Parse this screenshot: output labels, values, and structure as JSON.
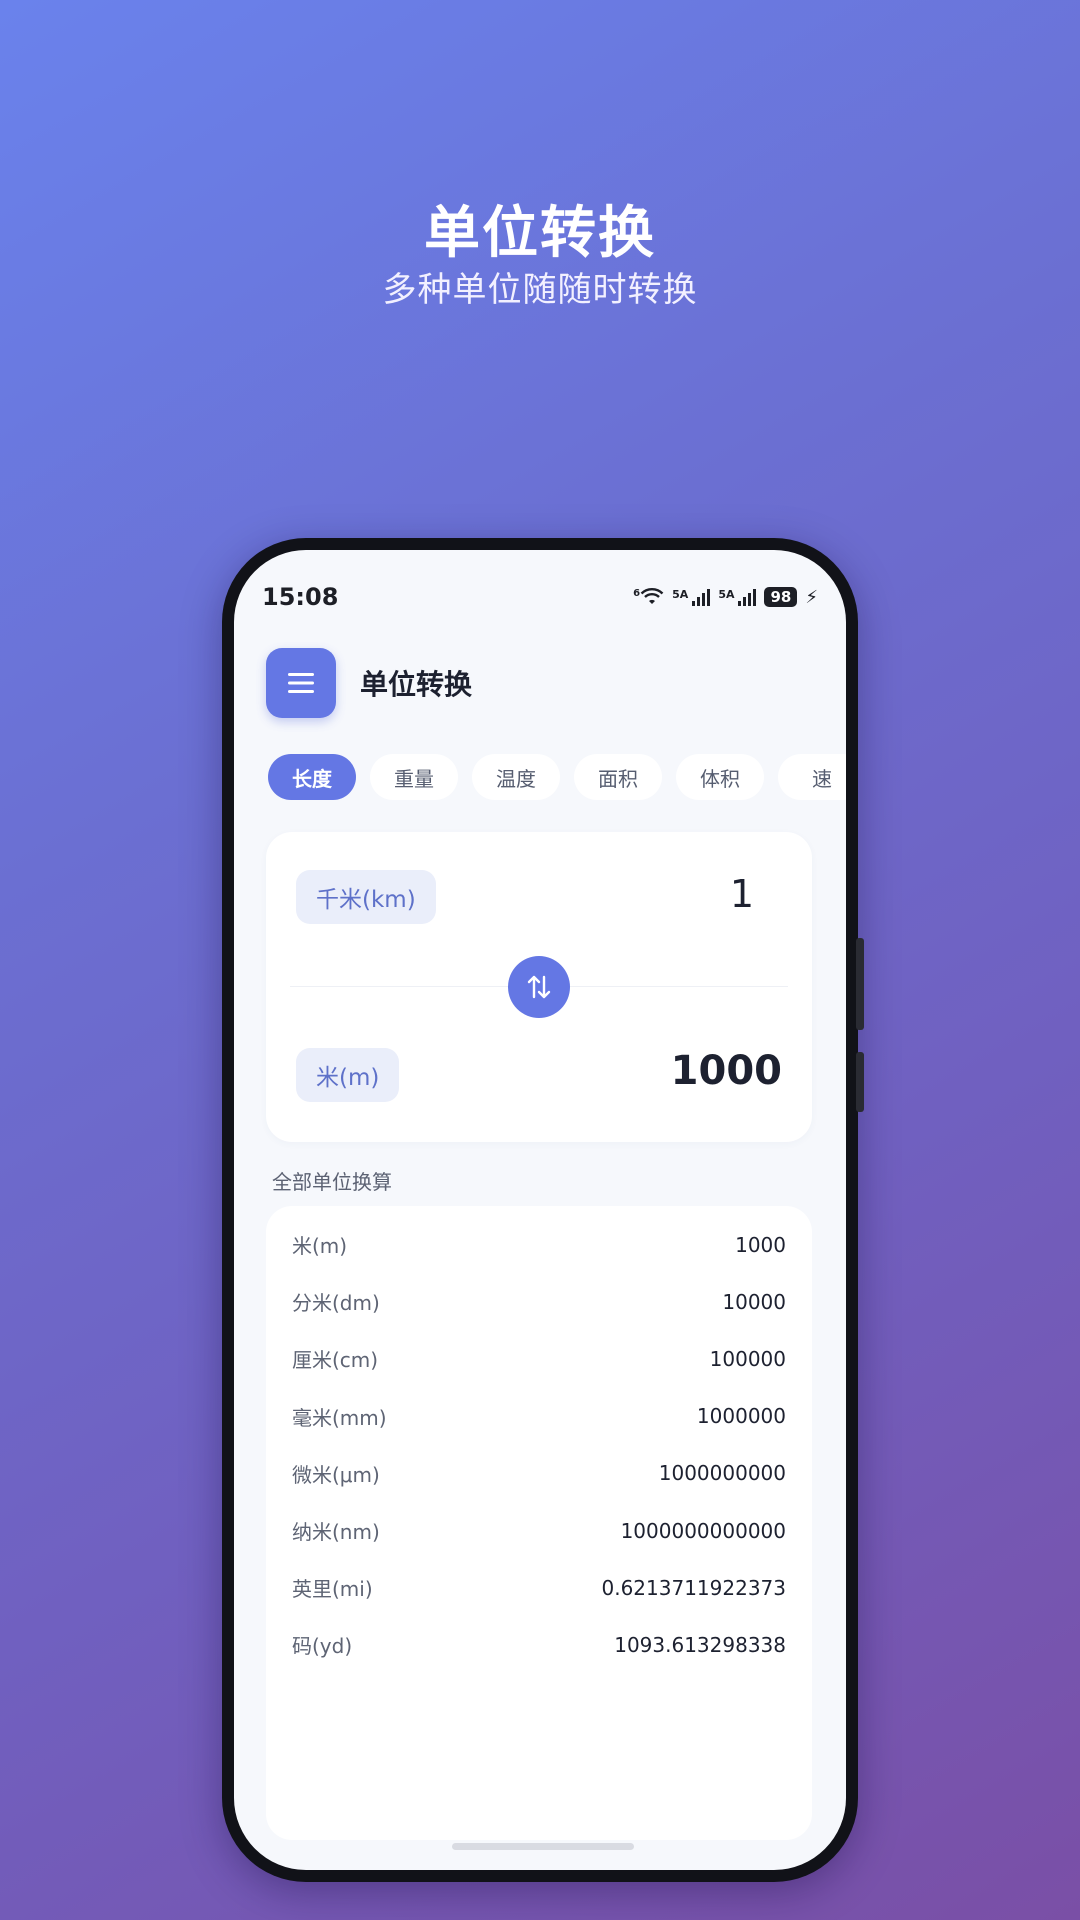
{
  "promo": {
    "title": "单位转换",
    "subtitle": "多种单位随随时转换"
  },
  "status_bar": {
    "time": "15:08",
    "wifi_label": "6",
    "signal1_label": "5A",
    "signal2_label": "5A",
    "battery": "98"
  },
  "header": {
    "menu_icon": "menu-icon",
    "title": "单位转换"
  },
  "tabs": [
    {
      "label": "长度",
      "active": true
    },
    {
      "label": "重量",
      "active": false
    },
    {
      "label": "温度",
      "active": false
    },
    {
      "label": "面积",
      "active": false
    },
    {
      "label": "体积",
      "active": false
    },
    {
      "label": "速",
      "active": false
    }
  ],
  "converter": {
    "from_unit": "千米(km)",
    "from_value": "1",
    "to_unit": "米(m)",
    "to_value": "1000",
    "swap_icon": "swap-vertical-icon"
  },
  "all_units": {
    "label": "全部单位换算",
    "rows": [
      {
        "name": "米(m)",
        "value": "1000"
      },
      {
        "name": "分米(dm)",
        "value": "10000"
      },
      {
        "name": "厘米(cm)",
        "value": "100000"
      },
      {
        "name": "毫米(mm)",
        "value": "1000000"
      },
      {
        "name": "微米(μm)",
        "value": "1000000000"
      },
      {
        "name": "纳米(nm)",
        "value": "1000000000000"
      },
      {
        "name": "英里(mi)",
        "value": "0.6213711922373"
      },
      {
        "name": "码(yd)",
        "value": "1093.613298338"
      }
    ]
  },
  "colors": {
    "accent": "#6477e4",
    "background_start": "#6a82ec",
    "background_end": "#7a4fa6"
  }
}
